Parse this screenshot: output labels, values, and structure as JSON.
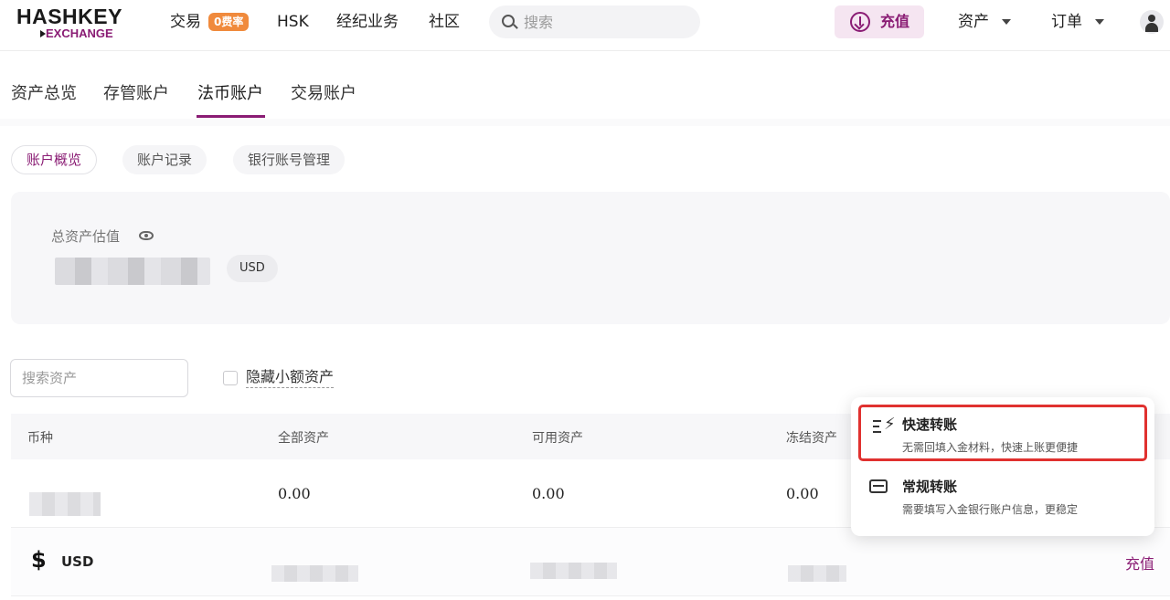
{
  "header": {
    "logo_top": "HASHKEY",
    "logo_bottom": "EXCHANGE",
    "nav": [
      {
        "label": "交易",
        "badge": "0费率"
      },
      {
        "label": "HSK"
      },
      {
        "label": "经纪业务"
      },
      {
        "label": "社区"
      }
    ],
    "search_placeholder": "搜索",
    "deposit_label": "充值",
    "assets_label": "资产",
    "orders_label": "订单"
  },
  "tabs": [
    "资产总览",
    "存管账户",
    "法币账户",
    "交易账户"
  ],
  "active_tab": "法币账户",
  "subtabs": [
    "账户概览",
    "账户记录",
    "银行账号管理"
  ],
  "overview": {
    "label": "总资产估值",
    "currency": "USD"
  },
  "filter": {
    "search_placeholder": "搜索资产",
    "hide_small_label": "隐藏小额资产"
  },
  "table": {
    "columns": [
      "币种",
      "全部资产",
      "可用资产",
      "冻结资产"
    ],
    "rows": [
      {
        "total": "0.00",
        "available": "0.00",
        "frozen": "0.00"
      },
      {
        "currency": "USD",
        "action": "充值"
      }
    ]
  },
  "dropdown": {
    "options": [
      {
        "title": "快速转账",
        "desc": "无需回填入金材料，快速上账更便捷"
      },
      {
        "title": "常规转账",
        "desc": "需要填写入金银行账户信息，更稳定"
      }
    ]
  },
  "colors": {
    "accent": "#8a1c74",
    "badge": "#f08a3c",
    "highlight": "#e0312f"
  }
}
